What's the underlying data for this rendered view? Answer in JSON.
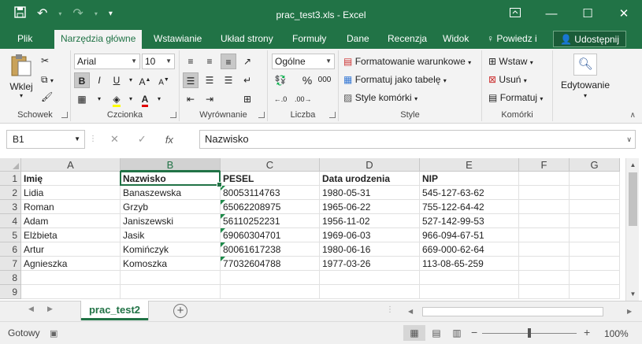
{
  "window": {
    "title": "prac_test3.xls - Excel",
    "icons": {
      "save": "save-icon",
      "undo": "undo-icon",
      "redo": "redo-icon",
      "customize": "customize-qat-icon"
    }
  },
  "tabs": [
    {
      "label": "Plik"
    },
    {
      "label": "Narzędzia główne",
      "active": true
    },
    {
      "label": "Wstawianie"
    },
    {
      "label": "Układ strony"
    },
    {
      "label": "Formuły"
    },
    {
      "label": "Dane"
    },
    {
      "label": "Recenzja"
    },
    {
      "label": "Widok"
    },
    {
      "label": "Powiedz i"
    }
  ],
  "share_label": "Udostępnij",
  "ribbon": {
    "clipboard": {
      "label": "Schowek",
      "paste": "Wklej"
    },
    "font": {
      "label": "Czcionka",
      "name": "Arial",
      "size": "10",
      "bold": "B",
      "italic": "I",
      "underline": "U"
    },
    "alignment": {
      "label": "Wyrównanie"
    },
    "number": {
      "label": "Liczba",
      "format": "Ogólne",
      "percent": "%",
      "thousands": "000"
    },
    "styles": {
      "label": "Style",
      "conditional": "Formatowanie warunkowe",
      "table": "Formatuj jako tabelę",
      "cell": "Style komórki"
    },
    "cells": {
      "label": "Komórki",
      "insert": "Wstaw",
      "delete": "Usuń",
      "format": "Formatuj"
    },
    "editing": {
      "label": "Edytowanie"
    }
  },
  "formula_bar": {
    "name_box": "B1",
    "fx": "fx",
    "content": "Nazwisko"
  },
  "grid": {
    "columns": [
      "A",
      "B",
      "C",
      "D",
      "E",
      "F",
      "G"
    ],
    "rows": [
      "1",
      "2",
      "3",
      "4",
      "5",
      "6",
      "7",
      "8",
      "9"
    ],
    "selected_column": "B",
    "selected_cell": "B1",
    "cells": [
      [
        "Imię",
        "Nazwisko",
        "PESEL",
        "Data urodzenia",
        "NIP",
        "",
        ""
      ],
      [
        "Lidia",
        "Banaszewska",
        "80053114763",
        "1980-05-31",
        "545-127-63-62",
        "",
        ""
      ],
      [
        "Roman",
        "Grzyb",
        "65062208975",
        "1965-06-22",
        "755-122-64-42",
        "",
        ""
      ],
      [
        "Adam",
        "Janiszewski",
        "56110252231",
        "1956-11-02",
        "527-142-99-53",
        "",
        ""
      ],
      [
        "Elżbieta",
        "Jasik",
        "69060304701",
        "1969-06-03",
        "966-094-67-51",
        "",
        ""
      ],
      [
        "Artur",
        "Komińczyk",
        "80061617238",
        "1980-06-16",
        "669-000-62-64",
        "",
        ""
      ],
      [
        "Agnieszka",
        "Komoszka",
        "77032604788",
        "1977-03-26",
        "113-08-65-259",
        "",
        ""
      ],
      [
        "",
        "",
        "",
        "",
        "",
        "",
        ""
      ],
      [
        "",
        "",
        "",
        "",
        "",
        "",
        ""
      ]
    ]
  },
  "sheet_tab": "prac_test2",
  "status": {
    "ready": "Gotowy",
    "zoom": "100%",
    "zoom_level": 0.5
  }
}
